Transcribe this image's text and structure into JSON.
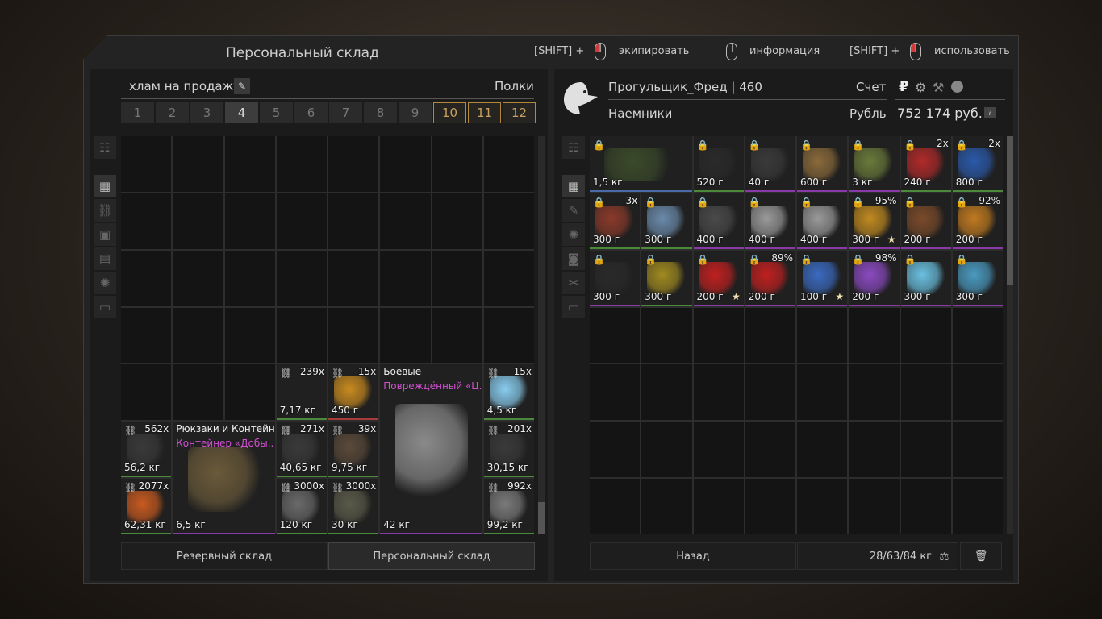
{
  "header": {
    "title": "Персональный склад",
    "equip_key": "[SHIFT] +",
    "equip_label": "экипировать",
    "info_label": "информация",
    "use_key": "[SHIFT] +",
    "use_label": "использовать"
  },
  "left": {
    "filter_label": "хлам на продажу",
    "shelves_label": "Полки",
    "tabs": [
      "1",
      "2",
      "3",
      "4",
      "5",
      "6",
      "7",
      "8",
      "9",
      "10",
      "11",
      "12"
    ],
    "active_tab": "4",
    "items": [
      {
        "name": "item-a",
        "count": "239x",
        "weight": "7,17 кг",
        "col": 4,
        "row": 5,
        "w": 1,
        "h": 1,
        "grade": "green",
        "art": "#333"
      },
      {
        "name": "item-b",
        "count": "15x",
        "weight": "450 г",
        "col": 5,
        "row": 5,
        "w": 1,
        "h": 1,
        "grade": "red",
        "art": "#c88a20"
      },
      {
        "name": "item-c",
        "count": "15x",
        "weight": "4,5 кг",
        "col": 8,
        "row": 5,
        "w": 1,
        "h": 1,
        "grade": "green",
        "art": "#88ccee"
      },
      {
        "name": "item-d",
        "count": "562x",
        "weight": "56,2 кг",
        "col": 1,
        "row": 6,
        "w": 1,
        "h": 1,
        "grade": "green",
        "art": "#3a3a3a"
      },
      {
        "name": "item-e",
        "sub": "Рюкзаки и Контейнеры",
        "sub2": "Контейнер «Добы..",
        "weight": "6,5 кг",
        "col": 2,
        "row": 6,
        "w": 2,
        "h": 2,
        "grade": "purple",
        "art": "#6a5a3a"
      },
      {
        "name": "item-f",
        "count": "271x",
        "weight": "40,65 кг",
        "col": 4,
        "row": 6,
        "w": 1,
        "h": 1,
        "grade": "green",
        "art": "#3a3a3a"
      },
      {
        "name": "item-g",
        "count": "39x",
        "weight": "9,75 кг",
        "col": 5,
        "row": 6,
        "w": 1,
        "h": 1,
        "grade": "green",
        "art": "#5a4a3a"
      },
      {
        "name": "item-h",
        "sub": "Боевые",
        "sub2": "Повреждённый «Ц..",
        "weight": "42 кг",
        "col": 6,
        "row": 5,
        "w": 2,
        "h": 3,
        "grade": "purple",
        "art": "#8a8a8a"
      },
      {
        "name": "item-i",
        "count": "201x",
        "weight": "30,15 кг",
        "col": 8,
        "row": 6,
        "w": 1,
        "h": 1,
        "grade": "green",
        "art": "#3a3a3a"
      },
      {
        "name": "item-j",
        "count": "2077x",
        "weight": "62,31 кг",
        "col": 1,
        "row": 7,
        "w": 1,
        "h": 1,
        "grade": "green",
        "art": "#c85a20"
      },
      {
        "name": "item-k",
        "count": "3000x",
        "weight": "120 кг",
        "col": 4,
        "row": 7,
        "w": 1,
        "h": 1,
        "grade": "green",
        "art": "#6a6a6a"
      },
      {
        "name": "item-l",
        "count": "3000x",
        "weight": "30 кг",
        "col": 5,
        "row": 7,
        "w": 1,
        "h": 1,
        "grade": "green",
        "art": "#5a5a4a"
      },
      {
        "name": "item-m",
        "count": "992x",
        "weight": "99,2 кг",
        "col": 8,
        "row": 7,
        "w": 1,
        "h": 1,
        "grade": "green",
        "art": "#7a7a7a"
      }
    ],
    "btn_reserve": "Резервный склад",
    "btn_personal": "Персональный склад"
  },
  "right": {
    "player": "Прогульщик_Фред",
    "level": "460",
    "faction": "Наемники",
    "account_label": "Счет",
    "currency_label": "Рубль",
    "balance": "752 174 руб.",
    "help": "?",
    "items": [
      {
        "name": "item-1",
        "weight": "1,5 кг",
        "col": 1,
        "row": 1,
        "w": 2,
        "h": 1,
        "grade": "blue",
        "art": "#3a4a2a"
      },
      {
        "name": "item-2",
        "weight": "520 г",
        "col": 3,
        "row": 1,
        "w": 1,
        "h": 1,
        "grade": "green",
        "art": "#2a2a2a"
      },
      {
        "name": "item-3",
        "weight": "40 г",
        "col": 4,
        "row": 1,
        "w": 1,
        "h": 1,
        "grade": "purple",
        "art": "#3a3a3a"
      },
      {
        "name": "item-4",
        "weight": "600 г",
        "col": 5,
        "row": 1,
        "w": 1,
        "h": 1,
        "grade": "purple",
        "art": "#8a6a3a"
      },
      {
        "name": "item-5",
        "weight": "3 кг",
        "col": 6,
        "row": 1,
        "w": 1,
        "h": 1,
        "grade": "purple",
        "art": "#6a7a3a"
      },
      {
        "name": "item-6",
        "count": "2x",
        "weight": "240 г",
        "col": 7,
        "row": 1,
        "w": 1,
        "h": 1,
        "grade": "green",
        "art": "#b02a2a"
      },
      {
        "name": "item-7",
        "count": "2x",
        "weight": "800 г",
        "col": 8,
        "row": 1,
        "w": 1,
        "h": 1,
        "grade": "green",
        "art": "#2a5aaa"
      },
      {
        "name": "item-8",
        "count": "3x",
        "weight": "300 г",
        "col": 1,
        "row": 2,
        "w": 1,
        "h": 1,
        "grade": "green",
        "art": "#8a3a2a"
      },
      {
        "name": "item-9",
        "weight": "300 г",
        "col": 2,
        "row": 2,
        "w": 1,
        "h": 1,
        "grade": "green",
        "art": "#6a8aaa"
      },
      {
        "name": "item-10",
        "weight": "400 г",
        "col": 3,
        "row": 2,
        "w": 1,
        "h": 1,
        "grade": "purple",
        "art": "#4a4a4a"
      },
      {
        "name": "item-11",
        "weight": "400 г",
        "col": 4,
        "row": 2,
        "w": 1,
        "h": 1,
        "grade": "purple",
        "art": "#9a9a9a"
      },
      {
        "name": "item-12",
        "weight": "400 г",
        "col": 5,
        "row": 2,
        "w": 1,
        "h": 1,
        "grade": "purple",
        "art": "#9a9a9a"
      },
      {
        "name": "item-13",
        "count": "95%",
        "weight": "300 г",
        "star": "★",
        "col": 6,
        "row": 2,
        "w": 1,
        "h": 1,
        "grade": "purple",
        "art": "#c08a20"
      },
      {
        "name": "item-14",
        "weight": "200 г",
        "col": 7,
        "row": 2,
        "w": 1,
        "h": 1,
        "grade": "purple",
        "art": "#7a4a2a"
      },
      {
        "name": "item-15",
        "count": "92%",
        "weight": "200 г",
        "col": 8,
        "row": 2,
        "w": 1,
        "h": 1,
        "grade": "purple",
        "art": "#c07a20"
      },
      {
        "name": "item-16",
        "weight": "300 г",
        "col": 1,
        "row": 3,
        "w": 1,
        "h": 1,
        "grade": "purple",
        "art": "#2a2a2a"
      },
      {
        "name": "item-17",
        "weight": "300 г",
        "col": 2,
        "row": 3,
        "w": 1,
        "h": 1,
        "grade": "green",
        "art": "#a08a20"
      },
      {
        "name": "item-18",
        "weight": "200 г",
        "star": "★",
        "col": 3,
        "row": 3,
        "w": 1,
        "h": 1,
        "grade": "purple",
        "art": "#c02020"
      },
      {
        "name": "item-19",
        "count": "89%",
        "weight": "200 г",
        "col": 4,
        "row": 3,
        "w": 1,
        "h": 1,
        "grade": "purple",
        "art": "#c02020"
      },
      {
        "name": "item-20",
        "weight": "100 г",
        "star": "★",
        "col": 5,
        "row": 3,
        "w": 1,
        "h": 1,
        "grade": "purple",
        "art": "#3a6ac0"
      },
      {
        "name": "item-21",
        "count": "98%",
        "weight": "200 г",
        "col": 6,
        "row": 3,
        "w": 1,
        "h": 1,
        "grade": "purple",
        "art": "#8a4ac0"
      },
      {
        "name": "item-22",
        "weight": "300 г",
        "col": 7,
        "row": 3,
        "w": 1,
        "h": 1,
        "grade": "purple",
        "art": "#6ac0e0"
      },
      {
        "name": "item-23",
        "weight": "300 г",
        "col": 8,
        "row": 3,
        "w": 1,
        "h": 1,
        "grade": "purple",
        "art": "#4a9ac0"
      }
    ],
    "btn_back": "Назад",
    "weight": "28/63/84 кг"
  },
  "colors": {
    "green": "#4a8a3a",
    "blue": "#4a6aa8",
    "purple": "#8a3aa8",
    "red": "#a83a3a",
    "gold": "#b48a3a"
  }
}
